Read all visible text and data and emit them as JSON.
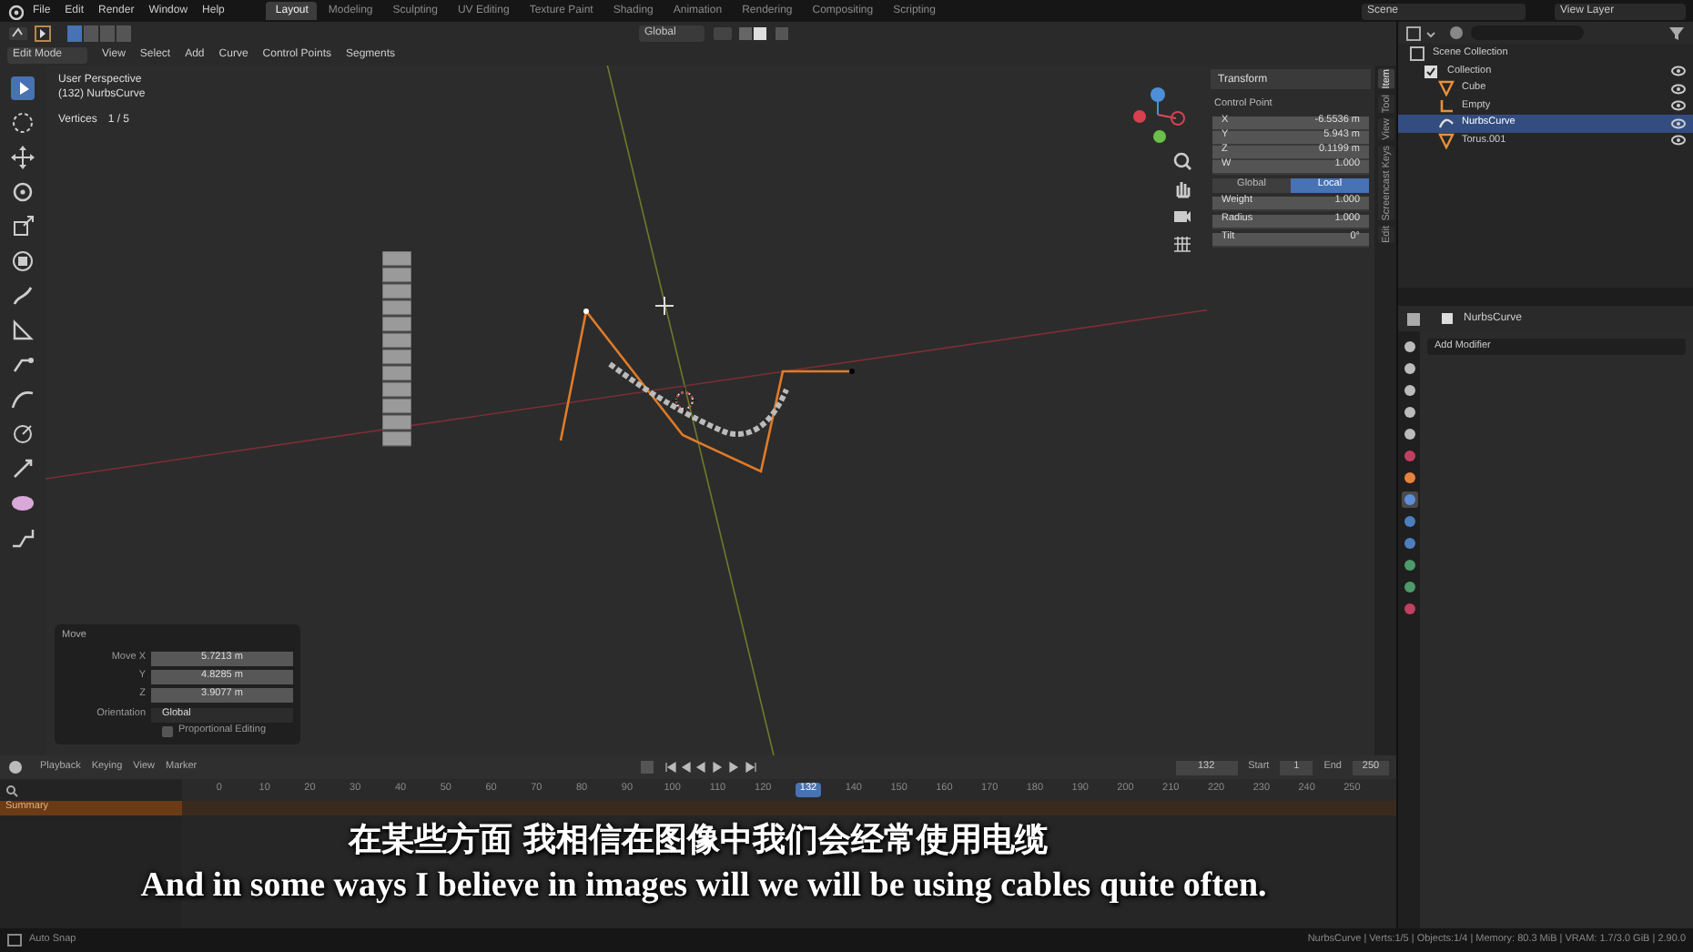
{
  "menu": [
    "File",
    "Edit",
    "Render",
    "Window",
    "Help"
  ],
  "workspaces": [
    {
      "label": "Layout",
      "selected": true
    },
    {
      "label": "Modeling",
      "selected": false
    },
    {
      "label": "Sculpting",
      "selected": false
    },
    {
      "label": "UV Editing",
      "selected": false
    },
    {
      "label": "Texture Paint",
      "selected": false
    },
    {
      "label": "Shading",
      "selected": false
    },
    {
      "label": "Animation",
      "selected": false
    },
    {
      "label": "Rendering",
      "selected": false
    },
    {
      "label": "Compositing",
      "selected": false
    },
    {
      "label": "Scripting",
      "selected": false
    }
  ],
  "scene": {
    "scene": "Scene",
    "view_layer": "View Layer"
  },
  "tool_header": {
    "orientation": "Global"
  },
  "mode_menu": {
    "mode": "Edit Mode",
    "items": [
      "View",
      "Select",
      "Add",
      "Curve",
      "Control Points",
      "Segments"
    ]
  },
  "viewport": {
    "overlay_lines": [
      "User Perspective",
      "(132) NurbsCurve"
    ],
    "stats_label": "Vertices",
    "stats_value": "1 / 5"
  },
  "transform": {
    "title": "Transform",
    "section": "Control Point",
    "coords": [
      {
        "label": "X",
        "value": "-6.5536 m"
      },
      {
        "label": "Y",
        "value": "5.943 m"
      },
      {
        "label": "Z",
        "value": "0.1199 m"
      },
      {
        "label": "W",
        "value": "1.000"
      }
    ],
    "space": [
      {
        "label": "Global",
        "selected": false
      },
      {
        "label": "Local",
        "selected": true
      }
    ],
    "props": [
      {
        "label": "Weight",
        "value": "1.000"
      },
      {
        "label": "Radius",
        "value": "1.000"
      },
      {
        "label": "Tilt",
        "value": "0°"
      }
    ]
  },
  "sidebar_tabs": [
    {
      "label": "Item",
      "selected": true
    },
    {
      "label": "Tool",
      "selected": false
    },
    {
      "label": "View",
      "selected": false
    },
    {
      "label": "Screencast Keys",
      "selected": false
    },
    {
      "label": "Edit",
      "selected": false
    }
  ],
  "outliner": [
    {
      "label": "Scene Collection",
      "kind": "scene",
      "selected": false,
      "children": [
        {
          "label": "Collection",
          "kind": "collection",
          "selected": false,
          "children": [
            {
              "label": "Cube",
              "kind": "mesh",
              "selected": false
            },
            {
              "label": "Empty",
              "kind": "empty",
              "selected": false
            },
            {
              "label": "NurbsCurve",
              "kind": "curve",
              "selected": true
            },
            {
              "label": "Torus.001",
              "kind": "mesh",
              "selected": false
            }
          ]
        }
      ]
    }
  ],
  "properties": {
    "object": "NurbsCurve",
    "add_modifier": "Add Modifier",
    "tabs": [
      {
        "kind": "tool",
        "selected": false
      },
      {
        "kind": "render",
        "selected": false
      },
      {
        "kind": "output",
        "selected": false
      },
      {
        "kind": "view_layer",
        "selected": false
      },
      {
        "kind": "scene",
        "selected": false
      },
      {
        "kind": "world",
        "selected": false
      },
      {
        "kind": "object",
        "selected": false
      },
      {
        "kind": "modifier",
        "selected": true
      },
      {
        "kind": "particles",
        "selected": false
      },
      {
        "kind": "physics",
        "selected": false
      },
      {
        "kind": "constraints",
        "selected": false
      },
      {
        "kind": "data",
        "selected": false
      },
      {
        "kind": "material",
        "selected": false
      }
    ]
  },
  "move_panel": {
    "title": "Move",
    "fields": [
      {
        "label": "Move X",
        "value": "5.7213 m"
      },
      {
        "label": "Y",
        "value": "4.8285 m"
      },
      {
        "label": "Z",
        "value": "3.9077 m"
      }
    ],
    "orientation_label": "Orientation",
    "orientation": "Global",
    "proportional": {
      "label": "Proportional Editing",
      "checked": false
    }
  },
  "timeline": {
    "menus": [
      "Playback",
      "Keying",
      "View",
      "Marker"
    ],
    "current": "132",
    "start_label": "Start",
    "start": "1",
    "end_label": "End",
    "end": "250",
    "channel": "Summary",
    "ticks": [
      {
        "label": "0",
        "selected": false
      },
      {
        "label": "10",
        "selected": false
      },
      {
        "label": "20",
        "selected": false
      },
      {
        "label": "30",
        "selected": false
      },
      {
        "label": "40",
        "selected": false
      },
      {
        "label": "50",
        "selected": false
      },
      {
        "label": "60",
        "selected": false
      },
      {
        "label": "70",
        "selected": false
      },
      {
        "label": "80",
        "selected": false
      },
      {
        "label": "90",
        "selected": false
      },
      {
        "label": "100",
        "selected": false
      },
      {
        "label": "110",
        "selected": false
      },
      {
        "label": "120",
        "selected": false
      },
      {
        "label": "132",
        "selected": true
      },
      {
        "label": "140",
        "selected": false
      },
      {
        "label": "150",
        "selected": false
      },
      {
        "label": "160",
        "selected": false
      },
      {
        "label": "170",
        "selected": false
      },
      {
        "label": "180",
        "selected": false
      },
      {
        "label": "190",
        "selected": false
      },
      {
        "label": "200",
        "selected": false
      },
      {
        "label": "210",
        "selected": false
      },
      {
        "label": "220",
        "selected": false
      },
      {
        "label": "230",
        "selected": false
      },
      {
        "label": "240",
        "selected": false
      },
      {
        "label": "250",
        "selected": false
      }
    ]
  },
  "subtitles": {
    "zh": "在某些方面 我相信在图像中我们会经常使用电缆",
    "en": "And in some ways I believe in images will we will be using cables quite often."
  },
  "status_bar": {
    "left": "Auto Snap",
    "right": "NurbsCurve | Verts:1/5 | Objects:1/4 | Memory: 80.3 MiB | VRAM: 1.7/3.0 GiB | 2.90.0"
  }
}
